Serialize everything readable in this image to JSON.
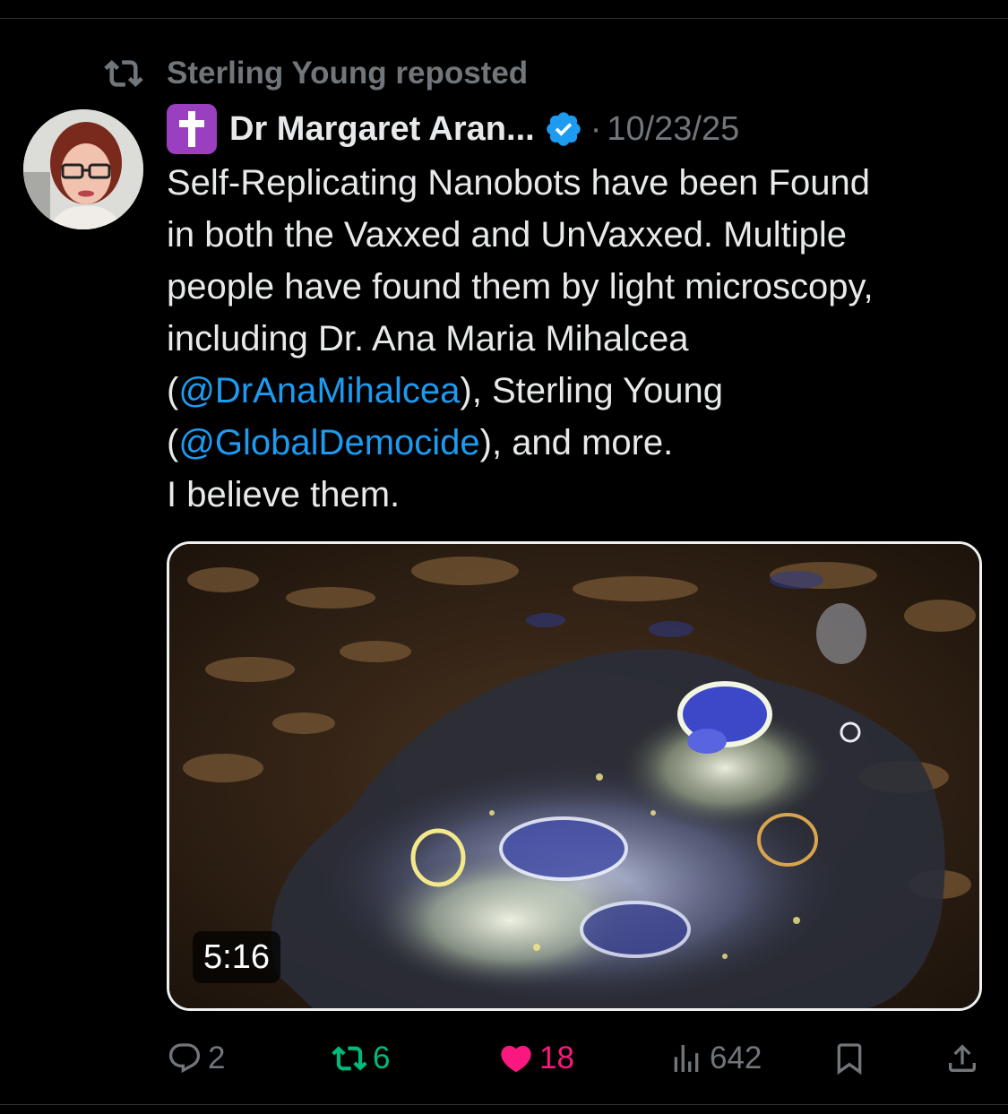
{
  "repost": {
    "label": "Sterling Young reposted",
    "icon": "repost-icon"
  },
  "author": {
    "emoji": "latin-cross-emoji",
    "name": "Dr Margaret Aran...",
    "verified": true,
    "separator": "·",
    "timestamp": "10/23/25"
  },
  "post": {
    "lines": {
      "l1": "Self-Replicating Nanobots have been Found",
      "l2": "in both the Vaxxed and UnVaxxed. Multiple",
      "l3": "people have found them by light microscopy,",
      "l4": "including Dr. Ana Maria Mihalcea",
      "l5_pre": "(",
      "l5_mention": "@DrAnaMihalcea",
      "l5_post": "), Sterling Young",
      "l6_pre": "(",
      "l6_mention": "@GlobalDemocide",
      "l6_post": "), and more.",
      "l7": "I believe them."
    }
  },
  "media": {
    "type": "video",
    "duration": "5:16"
  },
  "actions": {
    "replies": "2",
    "reposts": "6",
    "likes": "18",
    "views": "642"
  },
  "colors": {
    "background": "#000000",
    "text": "#e7e9ea",
    "muted": "#71767b",
    "mention": "#1d9bf0",
    "repost_active": "#00ba7c",
    "like_active": "#f91880",
    "verified": "#1d9bf0"
  }
}
